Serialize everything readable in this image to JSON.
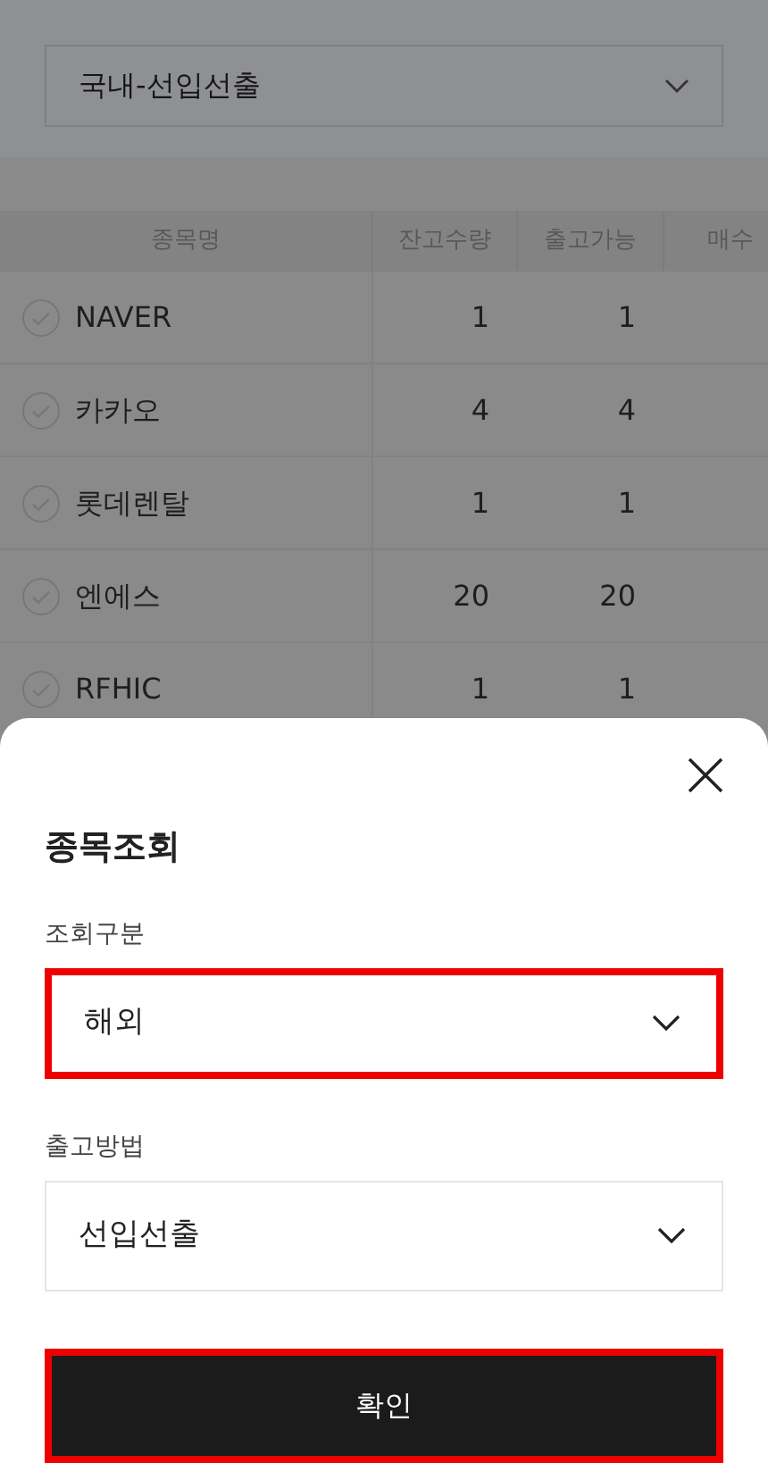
{
  "filter": {
    "value": "국내-선입선출"
  },
  "table": {
    "columns": [
      "종목명",
      "잔고수량",
      "출고가능",
      "매수"
    ],
    "rows": [
      {
        "checked": false,
        "cells": [
          "NAVER",
          "1",
          "1"
        ]
      },
      {
        "checked": false,
        "cells": [
          "카카오",
          "4",
          "4"
        ]
      },
      {
        "checked": false,
        "cells": [
          "롯데렌탈",
          "1",
          "1"
        ]
      },
      {
        "checked": false,
        "cells": [
          "엔에스",
          "20",
          "20"
        ]
      },
      {
        "checked": false,
        "cells": [
          "RFHIC",
          "1",
          "1"
        ]
      }
    ]
  },
  "sheet": {
    "title": "종목조회",
    "fields": [
      {
        "label": "조회구분",
        "value": "해외",
        "highlighted": true
      },
      {
        "label": "출고방법",
        "value": "선입선출",
        "highlighted": false
      }
    ],
    "button": {
      "label": "확인",
      "highlighted": true
    }
  }
}
